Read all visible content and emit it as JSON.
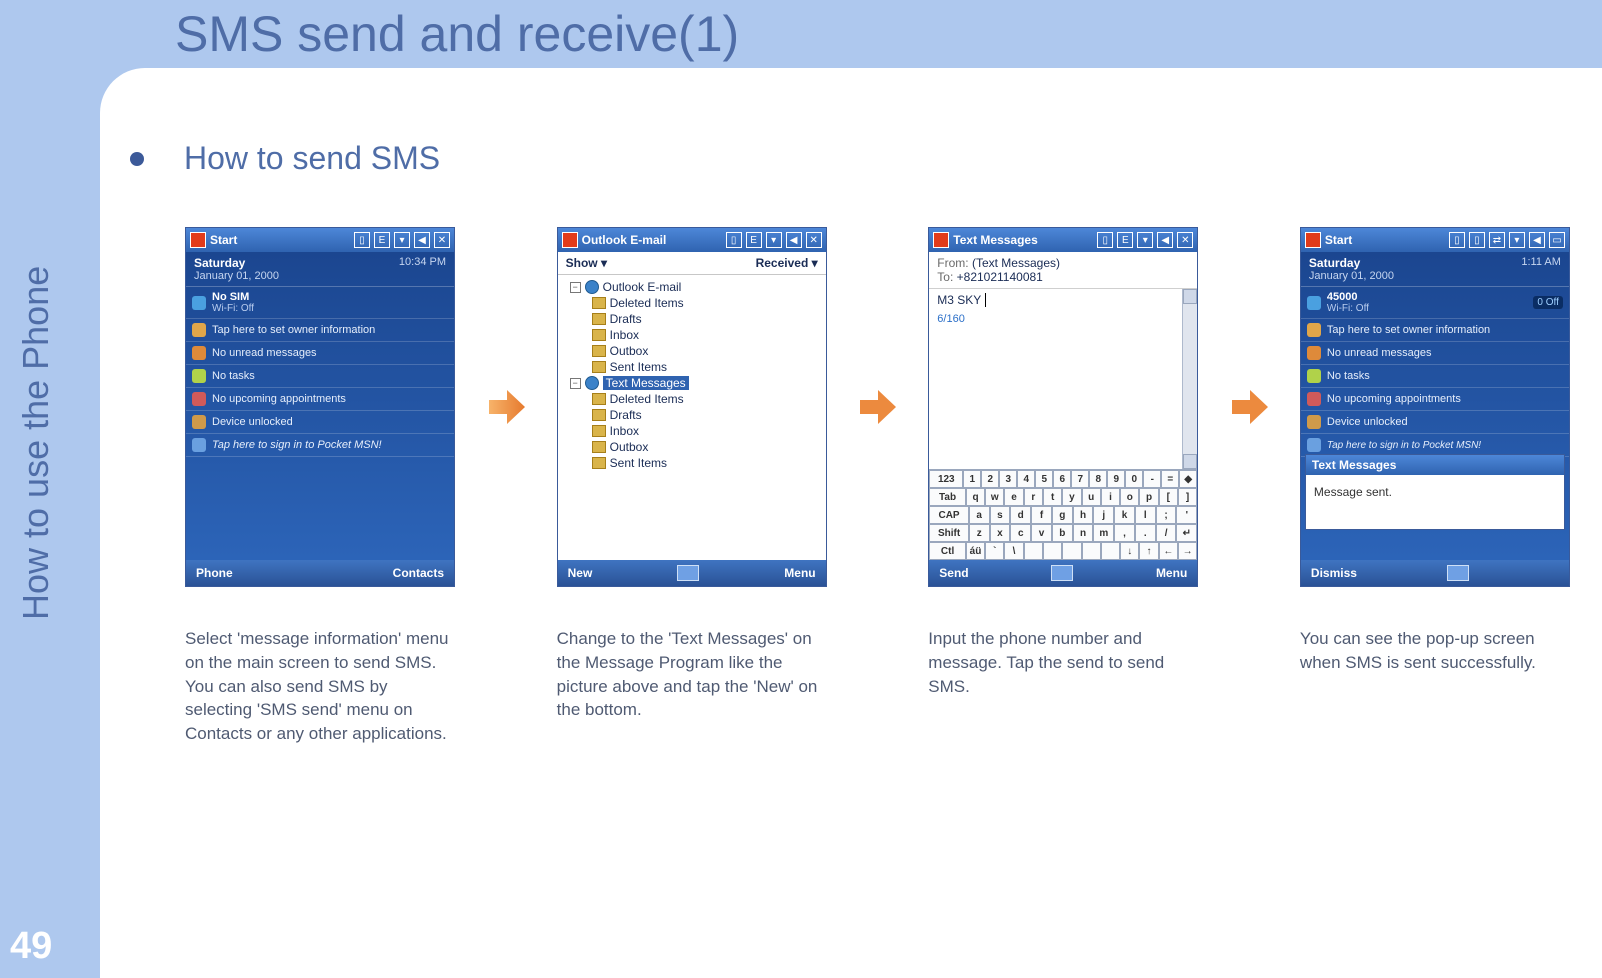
{
  "page": {
    "title": "SMS send and receive(1)",
    "section_title": "How to send SMS",
    "side_label": "How to use the Phone",
    "page_number": "49"
  },
  "screen1": {
    "titlebar": "Start",
    "date_weekday": "Saturday",
    "date_full": "January 01, 2000",
    "time": "10:34 PM",
    "rows": {
      "sim_title": "No SIM",
      "sim_sub": "Wi-Fi: Off",
      "owner": "Tap here to set owner information",
      "unread": "No unread messages",
      "tasks": "No tasks",
      "appts": "No upcoming appointments",
      "lock": "Device unlocked",
      "msn": "Tap here to sign in to Pocket MSN!"
    },
    "soft_left": "Phone",
    "soft_right": "Contacts",
    "caption": "Select 'message information' menu on the main screen to send SMS. You can also send SMS by selecting 'SMS send' menu on Contacts or any other applications."
  },
  "screen2": {
    "titlebar": "Outlook E-mail",
    "head_left": "Show ▾",
    "head_right": "Received ▾",
    "tree": {
      "root1": "Outlook E-mail",
      "r1_children": [
        "Deleted Items",
        "Drafts",
        "Inbox",
        "Outbox",
        "Sent Items"
      ],
      "root2": "Text Messages",
      "r2_children": [
        "Deleted Items",
        "Drafts",
        "Inbox",
        "Outbox",
        "Sent Items"
      ]
    },
    "soft_left": "New",
    "soft_right": "Menu",
    "caption": "Change to the 'Text Messages' on the Message Program like the picture above and tap the 'New' on the bottom."
  },
  "screen3": {
    "titlebar": "Text Messages",
    "from_label": "From:",
    "from_value": "(Text Messages)",
    "to_label": "To:",
    "to_value": "+821021140081",
    "msg_text": "M3 SKY",
    "char_count": "6/160",
    "kb_rows": [
      [
        "123",
        "1",
        "2",
        "3",
        "4",
        "5",
        "6",
        "7",
        "8",
        "9",
        "0",
        "-",
        "=",
        "◆"
      ],
      [
        "Tab",
        "q",
        "w",
        "e",
        "r",
        "t",
        "y",
        "u",
        "i",
        "o",
        "p",
        "[",
        "]"
      ],
      [
        "CAP",
        "a",
        "s",
        "d",
        "f",
        "g",
        "h",
        "j",
        "k",
        "l",
        ";",
        "'"
      ],
      [
        "Shift",
        "z",
        "x",
        "c",
        "v",
        "b",
        "n",
        "m",
        ",",
        ".",
        "/",
        "↵"
      ],
      [
        "Ctl",
        "áü",
        "`",
        "\\",
        "",
        "",
        "",
        "",
        "",
        "↓",
        "↑",
        "←",
        "→"
      ]
    ],
    "soft_left": "Send",
    "soft_right": "Menu",
    "caption": "Input the phone number and message. Tap the send to send SMS."
  },
  "screen4": {
    "titlebar": "Start",
    "date_weekday": "Saturday",
    "date_full": "January 01, 2000",
    "time": "1:11 AM",
    "rows": {
      "sim_title": "45000",
      "sim_sub": "Wi-Fi: Off",
      "sim_badge": "0 Off",
      "owner": "Tap here to set owner information",
      "unread": "No unread messages",
      "tasks": "No tasks",
      "appts": "No upcoming appointments",
      "lock": "Device unlocked",
      "msn": "Tap here to sign in to Pocket MSN!"
    },
    "popup_title": "Text Messages",
    "popup_body": "Message sent.",
    "soft_left": "Dismiss",
    "caption": "You can see the pop-up screen when SMS is sent successfully."
  }
}
